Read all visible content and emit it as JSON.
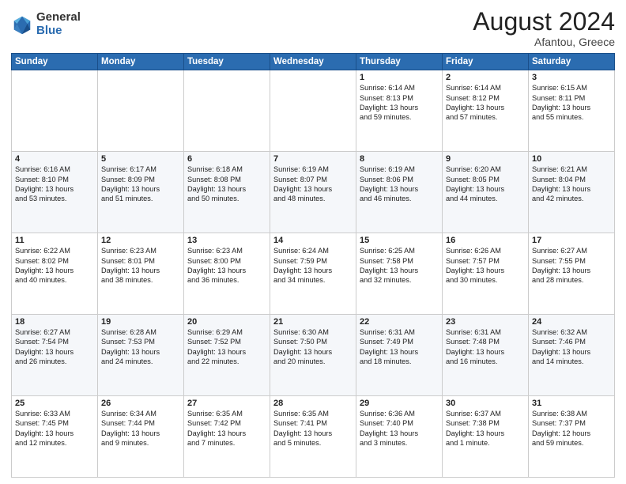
{
  "header": {
    "logo_general": "General",
    "logo_blue": "Blue",
    "month_year": "August 2024",
    "location": "Afantou, Greece"
  },
  "days_of_week": [
    "Sunday",
    "Monday",
    "Tuesday",
    "Wednesday",
    "Thursday",
    "Friday",
    "Saturday"
  ],
  "weeks": [
    [
      {
        "num": "",
        "text": ""
      },
      {
        "num": "",
        "text": ""
      },
      {
        "num": "",
        "text": ""
      },
      {
        "num": "",
        "text": ""
      },
      {
        "num": "1",
        "text": "Sunrise: 6:14 AM\nSunset: 8:13 PM\nDaylight: 13 hours\nand 59 minutes."
      },
      {
        "num": "2",
        "text": "Sunrise: 6:14 AM\nSunset: 8:12 PM\nDaylight: 13 hours\nand 57 minutes."
      },
      {
        "num": "3",
        "text": "Sunrise: 6:15 AM\nSunset: 8:11 PM\nDaylight: 13 hours\nand 55 minutes."
      }
    ],
    [
      {
        "num": "4",
        "text": "Sunrise: 6:16 AM\nSunset: 8:10 PM\nDaylight: 13 hours\nand 53 minutes."
      },
      {
        "num": "5",
        "text": "Sunrise: 6:17 AM\nSunset: 8:09 PM\nDaylight: 13 hours\nand 51 minutes."
      },
      {
        "num": "6",
        "text": "Sunrise: 6:18 AM\nSunset: 8:08 PM\nDaylight: 13 hours\nand 50 minutes."
      },
      {
        "num": "7",
        "text": "Sunrise: 6:19 AM\nSunset: 8:07 PM\nDaylight: 13 hours\nand 48 minutes."
      },
      {
        "num": "8",
        "text": "Sunrise: 6:19 AM\nSunset: 8:06 PM\nDaylight: 13 hours\nand 46 minutes."
      },
      {
        "num": "9",
        "text": "Sunrise: 6:20 AM\nSunset: 8:05 PM\nDaylight: 13 hours\nand 44 minutes."
      },
      {
        "num": "10",
        "text": "Sunrise: 6:21 AM\nSunset: 8:04 PM\nDaylight: 13 hours\nand 42 minutes."
      }
    ],
    [
      {
        "num": "11",
        "text": "Sunrise: 6:22 AM\nSunset: 8:02 PM\nDaylight: 13 hours\nand 40 minutes."
      },
      {
        "num": "12",
        "text": "Sunrise: 6:23 AM\nSunset: 8:01 PM\nDaylight: 13 hours\nand 38 minutes."
      },
      {
        "num": "13",
        "text": "Sunrise: 6:23 AM\nSunset: 8:00 PM\nDaylight: 13 hours\nand 36 minutes."
      },
      {
        "num": "14",
        "text": "Sunrise: 6:24 AM\nSunset: 7:59 PM\nDaylight: 13 hours\nand 34 minutes."
      },
      {
        "num": "15",
        "text": "Sunrise: 6:25 AM\nSunset: 7:58 PM\nDaylight: 13 hours\nand 32 minutes."
      },
      {
        "num": "16",
        "text": "Sunrise: 6:26 AM\nSunset: 7:57 PM\nDaylight: 13 hours\nand 30 minutes."
      },
      {
        "num": "17",
        "text": "Sunrise: 6:27 AM\nSunset: 7:55 PM\nDaylight: 13 hours\nand 28 minutes."
      }
    ],
    [
      {
        "num": "18",
        "text": "Sunrise: 6:27 AM\nSunset: 7:54 PM\nDaylight: 13 hours\nand 26 minutes."
      },
      {
        "num": "19",
        "text": "Sunrise: 6:28 AM\nSunset: 7:53 PM\nDaylight: 13 hours\nand 24 minutes."
      },
      {
        "num": "20",
        "text": "Sunrise: 6:29 AM\nSunset: 7:52 PM\nDaylight: 13 hours\nand 22 minutes."
      },
      {
        "num": "21",
        "text": "Sunrise: 6:30 AM\nSunset: 7:50 PM\nDaylight: 13 hours\nand 20 minutes."
      },
      {
        "num": "22",
        "text": "Sunrise: 6:31 AM\nSunset: 7:49 PM\nDaylight: 13 hours\nand 18 minutes."
      },
      {
        "num": "23",
        "text": "Sunrise: 6:31 AM\nSunset: 7:48 PM\nDaylight: 13 hours\nand 16 minutes."
      },
      {
        "num": "24",
        "text": "Sunrise: 6:32 AM\nSunset: 7:46 PM\nDaylight: 13 hours\nand 14 minutes."
      }
    ],
    [
      {
        "num": "25",
        "text": "Sunrise: 6:33 AM\nSunset: 7:45 PM\nDaylight: 13 hours\nand 12 minutes."
      },
      {
        "num": "26",
        "text": "Sunrise: 6:34 AM\nSunset: 7:44 PM\nDaylight: 13 hours\nand 9 minutes."
      },
      {
        "num": "27",
        "text": "Sunrise: 6:35 AM\nSunset: 7:42 PM\nDaylight: 13 hours\nand 7 minutes."
      },
      {
        "num": "28",
        "text": "Sunrise: 6:35 AM\nSunset: 7:41 PM\nDaylight: 13 hours\nand 5 minutes."
      },
      {
        "num": "29",
        "text": "Sunrise: 6:36 AM\nSunset: 7:40 PM\nDaylight: 13 hours\nand 3 minutes."
      },
      {
        "num": "30",
        "text": "Sunrise: 6:37 AM\nSunset: 7:38 PM\nDaylight: 13 hours\nand 1 minute."
      },
      {
        "num": "31",
        "text": "Sunrise: 6:38 AM\nSunset: 7:37 PM\nDaylight: 12 hours\nand 59 minutes."
      }
    ]
  ]
}
